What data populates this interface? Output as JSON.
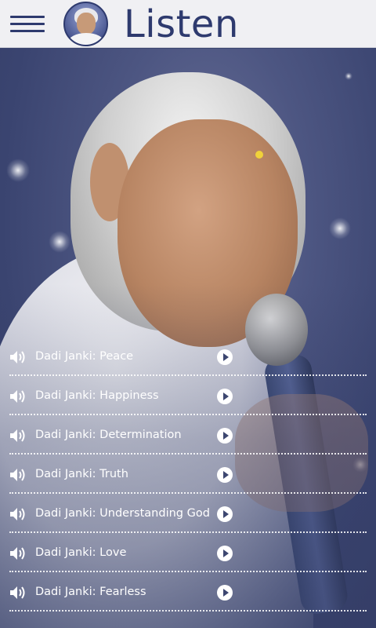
{
  "header": {
    "menu_icon": "hamburger-menu-icon",
    "avatar_icon": "profile-avatar",
    "title": "Listen"
  },
  "tracks": [
    {
      "label": "Dadi Janki: Peace"
    },
    {
      "label": "Dadi Janki: Happiness"
    },
    {
      "label": "Dadi Janki: Determination"
    },
    {
      "label": "Dadi Janki: Truth"
    },
    {
      "label": "Dadi Janki: Understanding God"
    },
    {
      "label": "Dadi Janki: Love"
    },
    {
      "label": "Dadi Janki: Fearless"
    }
  ],
  "icons": {
    "track_icon": "speaker-icon",
    "action_icon": "play-icon"
  },
  "colors": {
    "header_bg": "#f0f0f3",
    "accent": "#2e3a6e",
    "background": "#3c4670",
    "text": "#ffffff"
  }
}
